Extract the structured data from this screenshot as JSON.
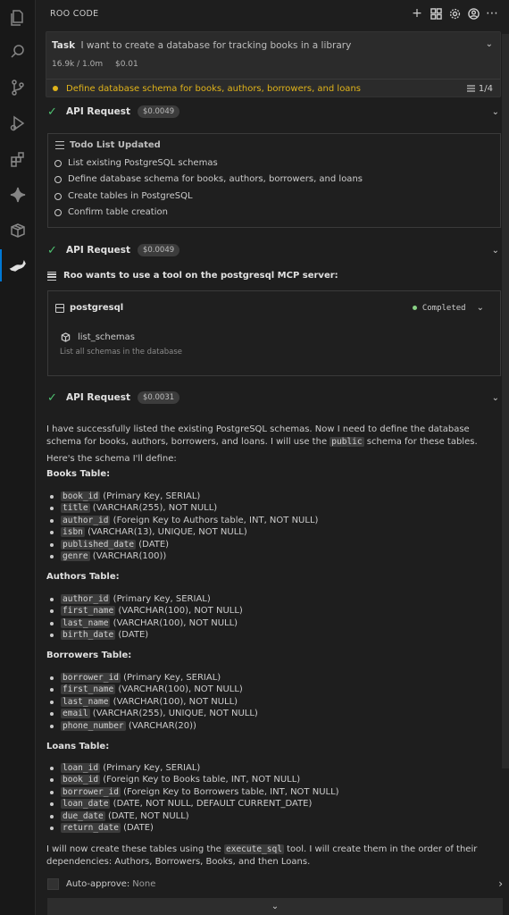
{
  "header": {
    "title": "ROO CODE"
  },
  "task": {
    "label": "Task",
    "text": "I want to create a database for tracking books in a library",
    "tokens": "16.9k / 1.0m",
    "cost": "$0.01",
    "current_todo": "Define database schema for books, authors, borrowers, and loans",
    "progress": "1/4"
  },
  "api_requests": [
    {
      "label": "API Request",
      "cost": "$0.0049"
    },
    {
      "label": "API Request",
      "cost": "$0.0049"
    },
    {
      "label": "API Request",
      "cost": "$0.0031"
    }
  ],
  "todo_list": {
    "title": "Todo List Updated",
    "items": [
      "List existing PostgreSQL schemas",
      "Define database schema for books, authors, borrowers, and loans",
      "Create tables in PostgreSQL",
      "Confirm table creation"
    ]
  },
  "mcp": {
    "prompt": "Roo wants to use a tool on the postgresql MCP server:",
    "server": "postgresql",
    "status": "Completed",
    "tool": "list_schemas",
    "tool_desc": "List all schemas in the database"
  },
  "message": {
    "intro_1": "I have successfully listed the existing PostgreSQL schemas. Now I need to define the database schema for books, authors, borrowers, and loans. I will use the ",
    "intro_code": "public",
    "intro_2": " schema for these tables.",
    "schema_intro": "Here's the schema I'll define:",
    "books": {
      "title": "Books Table:",
      "fields": [
        {
          "name": "book_id",
          "desc": "(Primary Key, SERIAL)"
        },
        {
          "name": "title",
          "desc": "(VARCHAR(255), NOT NULL)"
        },
        {
          "name": "author_id",
          "desc": "(Foreign Key to Authors table, INT, NOT NULL)"
        },
        {
          "name": "isbn",
          "desc": "(VARCHAR(13), UNIQUE, NOT NULL)"
        },
        {
          "name": "published_date",
          "desc": "(DATE)"
        },
        {
          "name": "genre",
          "desc": "(VARCHAR(100))"
        }
      ]
    },
    "authors": {
      "title": "Authors Table:",
      "fields": [
        {
          "name": "author_id",
          "desc": "(Primary Key, SERIAL)"
        },
        {
          "name": "first_name",
          "desc": "(VARCHAR(100), NOT NULL)"
        },
        {
          "name": "last_name",
          "desc": "(VARCHAR(100), NOT NULL)"
        },
        {
          "name": "birth_date",
          "desc": "(DATE)"
        }
      ]
    },
    "borrowers": {
      "title": "Borrowers Table:",
      "fields": [
        {
          "name": "borrower_id",
          "desc": "(Primary Key, SERIAL)"
        },
        {
          "name": "first_name",
          "desc": "(VARCHAR(100), NOT NULL)"
        },
        {
          "name": "last_name",
          "desc": "(VARCHAR(100), NOT NULL)"
        },
        {
          "name": "email",
          "desc": "(VARCHAR(255), UNIQUE, NOT NULL)"
        },
        {
          "name": "phone_number",
          "desc": "(VARCHAR(20))"
        }
      ]
    },
    "loans": {
      "title": "Loans Table:",
      "fields": [
        {
          "name": "loan_id",
          "desc": "(Primary Key, SERIAL)"
        },
        {
          "name": "book_id",
          "desc": "(Foreign Key to Books table, INT, NOT NULL)"
        },
        {
          "name": "borrower_id",
          "desc": "(Foreign Key to Borrowers table, INT, NOT NULL)"
        },
        {
          "name": "loan_date",
          "desc": "(DATE, NOT NULL, DEFAULT CURRENT_DATE)"
        },
        {
          "name": "due_date",
          "desc": "(DATE, NOT NULL)"
        },
        {
          "name": "return_date",
          "desc": "(DATE)"
        }
      ]
    },
    "outro_1": "I will now create these tables using the ",
    "outro_code": "execute_sql",
    "outro_2": " tool. I will create them in the order of their dependencies: Authors, Borrowers, Books, and then Loans."
  },
  "auto_approve": {
    "label": "Auto-approve:",
    "value": "None"
  },
  "colors": {
    "accent": "#0078d4",
    "todo_active": "#e0b31a",
    "success": "#4ec271",
    "status_dot": "#89d185"
  },
  "icons": {
    "activity_bar": [
      "explorer-icon",
      "search-icon",
      "source-control-icon",
      "run-debug-icon",
      "extensions-icon",
      "ai-sparkle-icon",
      "package-icon",
      "roo-kangaroo-icon"
    ],
    "header_actions": [
      "plus-icon",
      "grid-icon",
      "gear-icon",
      "account-icon",
      "more-icon"
    ]
  }
}
